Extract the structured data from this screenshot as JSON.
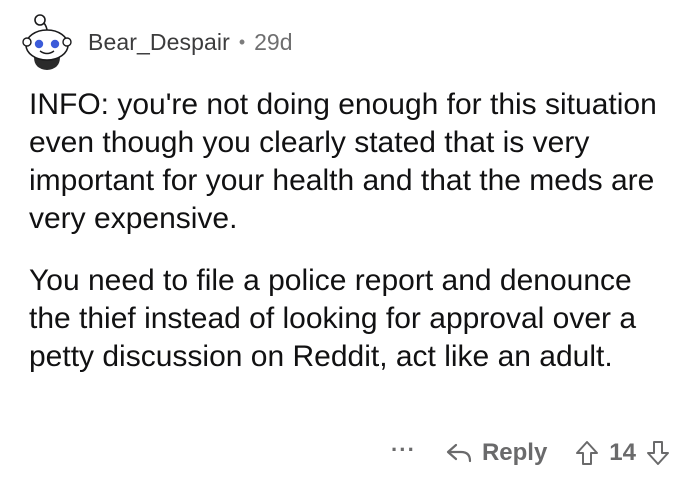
{
  "comment": {
    "username": "Bear_Despair",
    "separator": "•",
    "age": "29d",
    "avatar_icon": "snoo-avatar-icon",
    "paragraphs": [
      "INFO: you're not doing enough for this situation even though you clearly stated that is very important for your health and that the meds are very expensive.",
      "You need to file a police report and denounce the thief instead of looking for approval over a petty discussion on Reddit, act like an adult."
    ]
  },
  "actions": {
    "more_label": "···",
    "more_icon": "more-options-icon",
    "reply_icon": "reply-arrow-icon",
    "reply_label": "Reply",
    "upvote_icon": "upvote-arrow-icon",
    "score": "14",
    "downvote_icon": "downvote-arrow-icon"
  }
}
